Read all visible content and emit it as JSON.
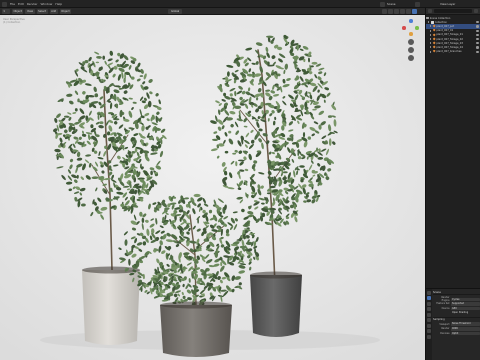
{
  "topbar": {
    "menu": [
      "File",
      "Edit",
      "Render",
      "Window",
      "Help"
    ],
    "scene_label": "Scene",
    "view_layer_label": "View Layer"
  },
  "viewport_header": {
    "buttons": [
      "Object",
      "View",
      "Select",
      "Add",
      "Object"
    ],
    "transform_label": "Global",
    "options_label": "Options"
  },
  "viewport_info": {
    "line1": "User Perspective",
    "line2": "(1) Collection"
  },
  "outliner": {
    "scene_collection": "Scene Collection",
    "collection": "Collection",
    "items": [
      "plant_007_pot",
      "plant_007_01",
      "plant_007_foliage_01",
      "plant_007_foliage_02",
      "plant_007_foliage_03",
      "plant_007_foliage_04",
      "plant_007_branches"
    ],
    "selected_index": 0
  },
  "properties": {
    "title": "Scene",
    "rows": [
      {
        "key": "Render Engine",
        "value": "Cycles"
      },
      {
        "key": "Feature Set",
        "value": "Supported"
      },
      {
        "key": "Device",
        "value": "GPU"
      },
      {
        "key": "",
        "value": "Open Shading"
      }
    ],
    "section": "Sampling",
    "section_rows": [
      {
        "key": "Viewport",
        "value": "Noise Threshold"
      },
      {
        "key": "Render",
        "value": "4096"
      },
      {
        "key": "Denoise",
        "value": "OptiX"
      }
    ]
  },
  "colors": {
    "viewport_bg": "#e9e9e9",
    "selection": "#334d80",
    "accent": "#4772b3",
    "foliage": "#4f6b45",
    "pot_white": "#d3d0cb",
    "pot_gray_dark": "#5d5d5d",
    "pot_terrazzo": "#7a7672"
  },
  "icons": {
    "gizmo_x": "x-axis-icon",
    "gizmo_y": "y-axis-icon",
    "gizmo_z": "z-axis-icon"
  }
}
